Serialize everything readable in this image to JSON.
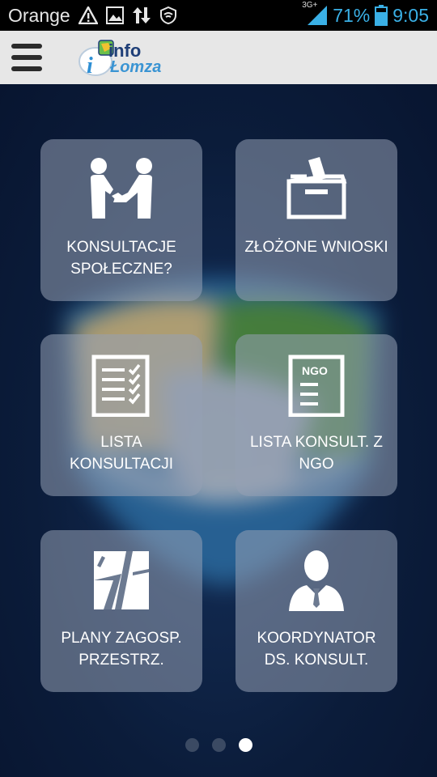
{
  "status_bar": {
    "carrier": "Orange",
    "network": "3G+",
    "battery": "71%",
    "time": "9:05"
  },
  "app_bar": {
    "logo_text_info": "info",
    "logo_text_lomza": "Łomza"
  },
  "tiles": [
    {
      "label": "KONSULTACJE SPOŁECZNE?",
      "icon": "handshake-icon"
    },
    {
      "label": "ZŁOŻONE WNIOSKI",
      "icon": "ballot-box-icon"
    },
    {
      "label": "LISTA KONSULTACJI",
      "icon": "checklist-icon"
    },
    {
      "label": "LISTA KONSULT. Z NGO",
      "icon": "ngo-document-icon",
      "icon_text": "NGO"
    },
    {
      "label": "PLANY ZAGOSP. PRZESTRZ.",
      "icon": "map-icon"
    },
    {
      "label": "KOORDYNATOR DS. KONSULT.",
      "icon": "person-icon"
    }
  ],
  "pager": {
    "total": 3,
    "active_index": 3
  }
}
